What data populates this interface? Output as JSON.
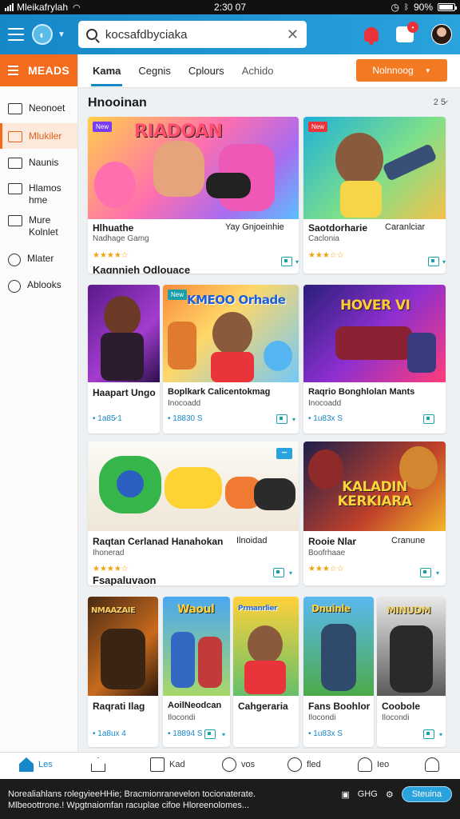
{
  "status_bar": {
    "carrier": "Mleikafrylah",
    "time": "2:30 07",
    "battery": "90%"
  },
  "header": {
    "search": {
      "value": "kocsafdbyciaka",
      "placeholder": ""
    }
  },
  "sidebar": {
    "title": "MEADS",
    "items": [
      {
        "label": "Neonoet"
      },
      {
        "label": "Mlukiler"
      },
      {
        "label": "Naunis"
      },
      {
        "label": "Hlamos hme"
      },
      {
        "label": "Mure Kolnlet"
      },
      {
        "label": "Mlater"
      },
      {
        "label": "Ablooks"
      }
    ]
  },
  "tabs": [
    {
      "label": "Kama"
    },
    {
      "label": "Cegnis"
    },
    {
      "label": "Cplours"
    },
    {
      "label": "Achido"
    }
  ],
  "sort_button": {
    "label": "Nolnnoog"
  },
  "section": {
    "title": "Hnooinan",
    "count": "2 5̷"
  },
  "row1": [
    {
      "tag": "New",
      "art_text": "RIADOAN",
      "title": "Hlhuathe",
      "sub": "Nadhage Gamg",
      "extra": "Yay Gnjoeinhie",
      "rating": "★★★★☆",
      "footer": "Kagnnieh Odlouace"
    },
    {
      "tag": "New",
      "title": "Saotdorharie",
      "sub": "Caclonia",
      "extra": "Caranlciar",
      "rating": "★★★☆☆"
    }
  ],
  "row2": [
    {
      "title": "Haapart Ungo",
      "price": "• 1a85̷ 1"
    },
    {
      "tag": "New",
      "art_text": "KMEOO Orhade",
      "title": "Boplkark Calicentokmag",
      "sub": "Inocoadd",
      "price": "• 18830 S"
    },
    {
      "art_text": "HOVER VI",
      "title": "Raqrio Bonghlolan Mants",
      "sub": "Inocoadd",
      "price": "• 1u83x S"
    }
  ],
  "row3": [
    {
      "title": "Raqtan Cerlanad Hanahokan",
      "sub": "Ihonerad",
      "extra": "Ilnoidad",
      "rating": "★★★★☆",
      "footer": "Fsapaluvaon"
    },
    {
      "art_text": "KALADIN KERKIARA",
      "title": "Rooie Nlar",
      "sub": "Boofrhaae",
      "extra": "Cranune",
      "rating": "★★★☆☆"
    }
  ],
  "row4": [
    {
      "art_text": "NMAAZAIE",
      "title": "Raqrati Ilag",
      "price": "• 1a8ux 4"
    },
    {
      "art_text": "Waoul",
      "title": "AoilNeodcan",
      "sub": "Ilocondi",
      "price": "• 18894 S"
    },
    {
      "art_text": "Prmanrlier",
      "title": "Cahgeraria"
    },
    {
      "art_text": "Dnuinle",
      "title": "Fans Boohlor",
      "sub": "Ilocondi",
      "price": "• 1u83x S"
    },
    {
      "art_text": "MINUDM",
      "title": "Coobole",
      "sub": "Ilocondi"
    }
  ],
  "bottom_nav": [
    {
      "label": "Les"
    },
    {
      "label": ""
    },
    {
      "label": "Kad"
    },
    {
      "label": "vos"
    },
    {
      "label": "fled"
    },
    {
      "label": "Ieo"
    },
    {
      "label": ""
    }
  ],
  "banner": {
    "line1": "Norealiahlans rolegyieeHHie; Bracmionranevelon tocionaterate.",
    "line2": "Mlbeoottrone.! Wpgtnaiomfan racuplae cifoe Hloreenolomes...",
    "code": "GHG",
    "button_label": "Steuina"
  },
  "colors": {
    "accent": "#1687c9",
    "orange": "#f36b1c",
    "teal": "#1aa0a8",
    "star": "#f2a20c"
  }
}
